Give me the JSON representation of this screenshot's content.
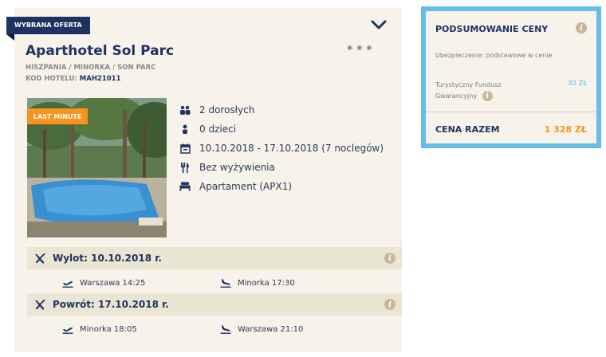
{
  "offer": {
    "ribbon": "WYBRANA OFERTA",
    "hotel_name": "Aparthotel Sol Parc",
    "stars": "✷✷✷",
    "location": "HISZPANIA / MINORKA / SON PARC",
    "code_label": "KOD HOTELU:",
    "code_value": "MAH21011",
    "badge": "LAST MINUTE",
    "details": {
      "adults": "2 dorosłych",
      "children": "0 dzieci",
      "dates": "10.10.2018 - 17.10.2018 (7 noclegów)",
      "board": "Bez wyżywienia",
      "room": "Apartament (APX1)"
    }
  },
  "flights": {
    "outbound": {
      "label": "Wylot: 10.10.2018 r.",
      "departure": "Warszawa 14:25",
      "arrival": "Minorka 17:30"
    },
    "return": {
      "label": "Powrót: 17.10.2018 r.",
      "departure": "Minorka 18:05",
      "arrival": "Warszawa 21:10"
    }
  },
  "summary": {
    "title": "PODSUMOWANIE CENY",
    "insurance": "Ubezpieczenie: podstawowe w cenie",
    "fund_label": "Turystyczny Fundusz Gwarancyjny",
    "fund_value": "30 ZŁ",
    "total_label": "CENA RAZEM",
    "total_value": "1 328 ZŁ"
  },
  "colors": {
    "navy": "#1e3363",
    "accent_blue": "#66bdea",
    "orange": "#f7931e",
    "card_bg": "#f7f3ea",
    "flight_bar": "#ebe5d3"
  },
  "icons": {
    "info": "i",
    "collapse": "chevron-down-icon"
  }
}
